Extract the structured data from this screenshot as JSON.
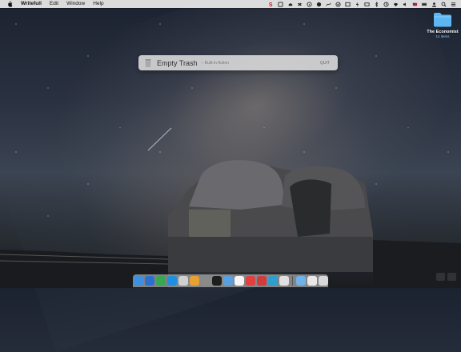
{
  "menubar": {
    "app_name": "Writefull",
    "menus": [
      "Edit",
      "Window",
      "Help"
    ]
  },
  "spotlight": {
    "title": "Empty Trash",
    "subtitle": "– Built-in Action",
    "hint": "QUIT"
  },
  "desktop": {
    "folder_name": "The Economist",
    "folder_count": "14 items"
  },
  "colors": {
    "menubar_bg": "#ececec",
    "folder_blue": "#5db6f2"
  }
}
